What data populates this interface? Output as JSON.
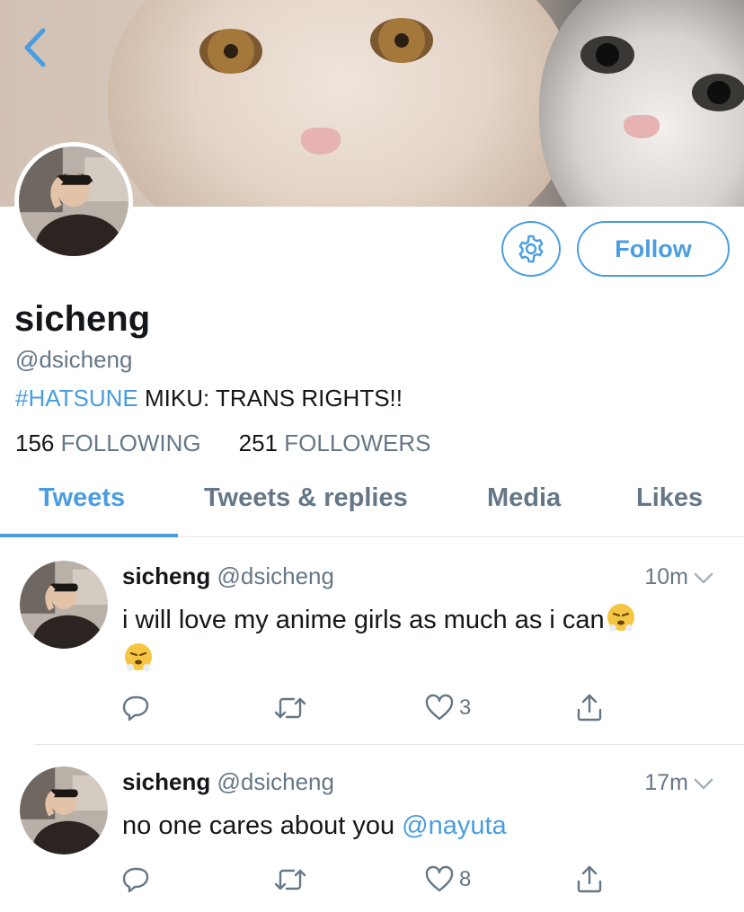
{
  "header": {
    "back_icon": "chevron-left-icon",
    "banner_image": "two-cats-banner"
  },
  "profile": {
    "avatar": "profile-photo",
    "settings_icon": "gear-icon",
    "follow_label": "Follow",
    "name": "sicheng",
    "handle": "@dsicheng",
    "bio_hashtag": "#HATSUNE",
    "bio_rest": " MIKU: TRANS RIGHTS!!",
    "following_count": "156",
    "following_label": "FOLLOWING",
    "followers_count": "251",
    "followers_label": "FOLLOWERS"
  },
  "tabs": [
    {
      "label": "Tweets",
      "active": true
    },
    {
      "label": "Tweets & replies",
      "active": false
    },
    {
      "label": "Media",
      "active": false
    },
    {
      "label": "Likes",
      "active": false
    }
  ],
  "tweets": [
    {
      "name": "sicheng",
      "handle": "@dsicheng",
      "time": "10m",
      "text": "i will love my anime girls as much as i can",
      "emoji": "face-with-steam-from-nose",
      "reply_count": "",
      "retweet_count": "",
      "like_count": "3"
    },
    {
      "name": "sicheng",
      "handle": "@dsicheng",
      "time": "17m",
      "text": "no one cares about you ",
      "mention": "@nayuta",
      "reply_count": "",
      "retweet_count": "",
      "like_count": "8"
    }
  ],
  "colors": {
    "accent": "#4a9de0",
    "secondary_text": "#657786",
    "primary_text": "#14171a",
    "divider": "#e1e8ed"
  }
}
